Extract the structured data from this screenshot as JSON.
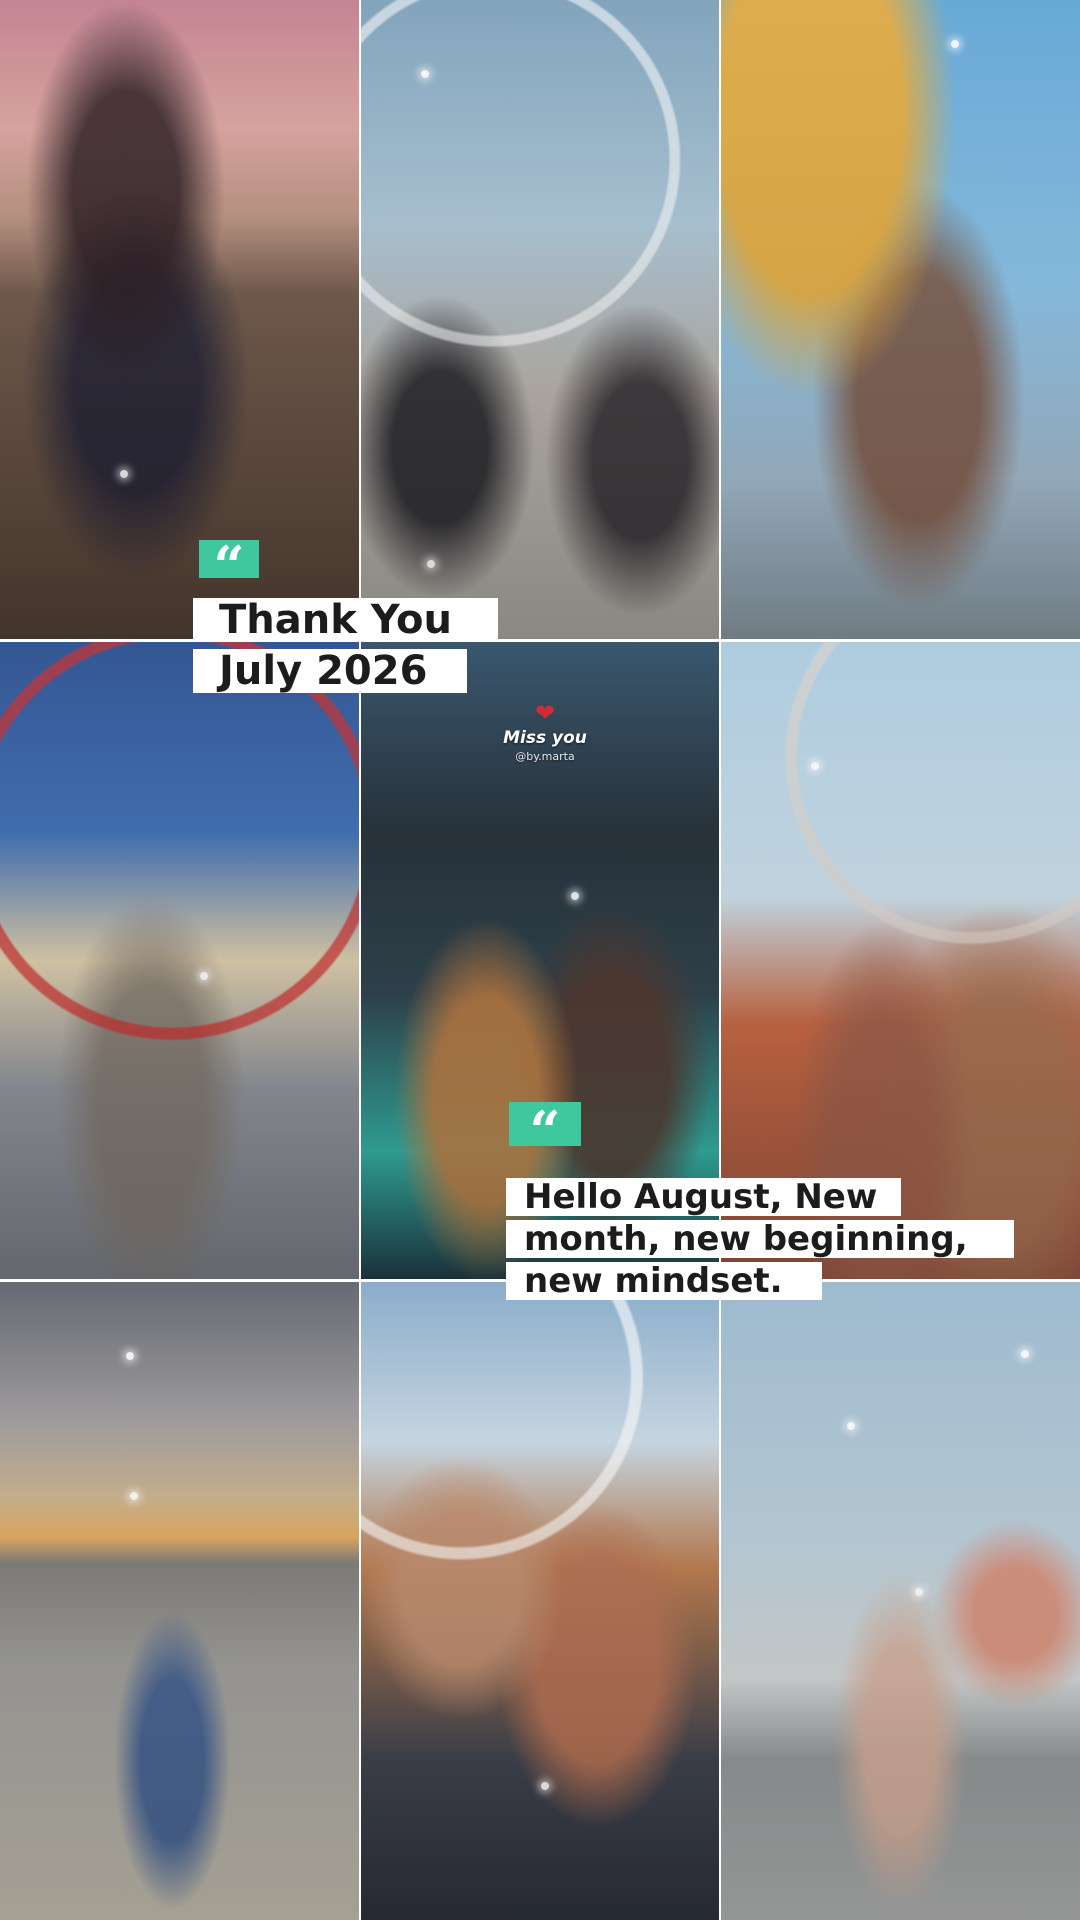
{
  "quote_block_1": {
    "icon": "quote-marks-icon",
    "lines": [
      "Thank You",
      "July 2026"
    ]
  },
  "quote_block_2": {
    "icon": "quote-marks-icon",
    "lines": [
      "Hello August, New",
      "month, new beginning,",
      "new mindset."
    ]
  },
  "sticker": {
    "icon": "broken-heart-icon",
    "title": "Miss you",
    "handle": "@by.marta"
  },
  "photos": [
    "friends-piggyback-beach-sunset",
    "friends-holding-hands-ferris-wheel",
    "friends-piggyback-swing-ride",
    "friends-hugging-boardwalk-ferris-wheel",
    "friends-concert-stage-kiss",
    "friends-laughing-ferris-wheel",
    "friends-parking-lot-sunset",
    "friends-ice-cream-amusement-park",
    "friends-fairground-posing"
  ],
  "colors": {
    "quote_accent": "#3fc79e",
    "text_strip_bg": "#ffffff",
    "text": "#1c1c1c"
  }
}
